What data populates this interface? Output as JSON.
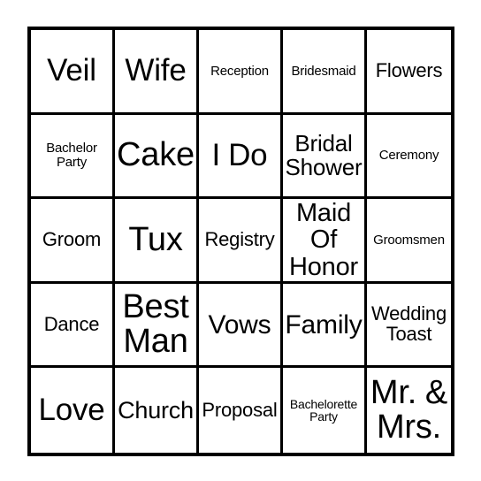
{
  "card": {
    "type": "bingo-card",
    "theme": "Wedding",
    "grid": {
      "columns": 5,
      "rows": 5
    },
    "colors": {
      "border": "#000000",
      "background": "#ffffff",
      "text": "#000000"
    },
    "cells": [
      {
        "text": "Veil",
        "size": "lg"
      },
      {
        "text": "Wife",
        "size": "lg"
      },
      {
        "text": "Reception",
        "size": "xs"
      },
      {
        "text": "Bridesmaid",
        "size": "xs"
      },
      {
        "text": "Flowers",
        "size": "sm"
      },
      {
        "text": "Bachelor\nParty",
        "size": "xs"
      },
      {
        "text": "Cake",
        "size": "xl"
      },
      {
        "text": "I Do",
        "size": "lg"
      },
      {
        "text": "Bridal\nShower",
        "size": "md"
      },
      {
        "text": "Ceremony",
        "size": "xs"
      },
      {
        "text": "Groom",
        "size": "sm"
      },
      {
        "text": "Tux",
        "size": "xl"
      },
      {
        "text": "Registry",
        "size": "sm"
      },
      {
        "text": "Maid\nOf\nHonor",
        "size": "md"
      },
      {
        "text": "Groomsmen",
        "size": "xs"
      },
      {
        "text": "Dance",
        "size": "sm"
      },
      {
        "text": "Best\nMan",
        "size": "xl"
      },
      {
        "text": "Vows",
        "size": "md"
      },
      {
        "text": "Family",
        "size": "md"
      },
      {
        "text": "Wedding\nToast",
        "size": "sm"
      },
      {
        "text": "Love",
        "size": "lg"
      },
      {
        "text": "Church",
        "size": "md"
      },
      {
        "text": "Proposal",
        "size": "sm"
      },
      {
        "text": "Bachelorette\nParty",
        "size": "xxs"
      },
      {
        "text": "Mr. &\nMrs.",
        "size": "xl"
      }
    ]
  }
}
